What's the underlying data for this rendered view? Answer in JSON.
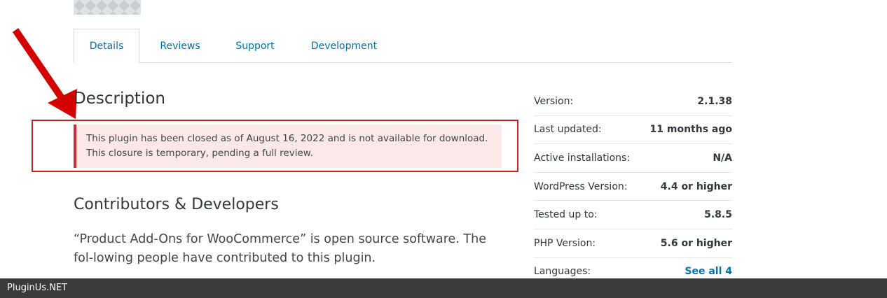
{
  "tabs": [
    {
      "label": "Details",
      "active": true
    },
    {
      "label": "Reviews"
    },
    {
      "label": "Support"
    },
    {
      "label": "Development"
    }
  ],
  "description": {
    "heading": "Description",
    "notice_line1": "This plugin has been closed as of August 16, 2022 and is not available for download.",
    "notice_line2": "This closure is temporary, pending a full review."
  },
  "contributors": {
    "heading": "Contributors & Developers",
    "text": "“Product Add-Ons for WooCommerce” is open source software. The fol-lowing people have contributed to this plugin."
  },
  "meta": [
    {
      "label": "Version:",
      "value": "2.1.38"
    },
    {
      "label": "Last updated:",
      "value": "11 months ago"
    },
    {
      "label": "Active installations:",
      "value": "N/A"
    },
    {
      "label": "WordPress Version:",
      "value": "4.4 or higher"
    },
    {
      "label": "Tested up to:",
      "value": "5.8.5"
    },
    {
      "label": "PHP Version:",
      "value": "5.6 or higher"
    },
    {
      "label": "Languages:",
      "value": "See all 4"
    }
  ],
  "footer": {
    "label": "PluginUs.NET"
  },
  "colors": {
    "accent": "#0073aa",
    "annotation_red": "#cc1f1f",
    "notice_bg": "#fbe8e8"
  }
}
